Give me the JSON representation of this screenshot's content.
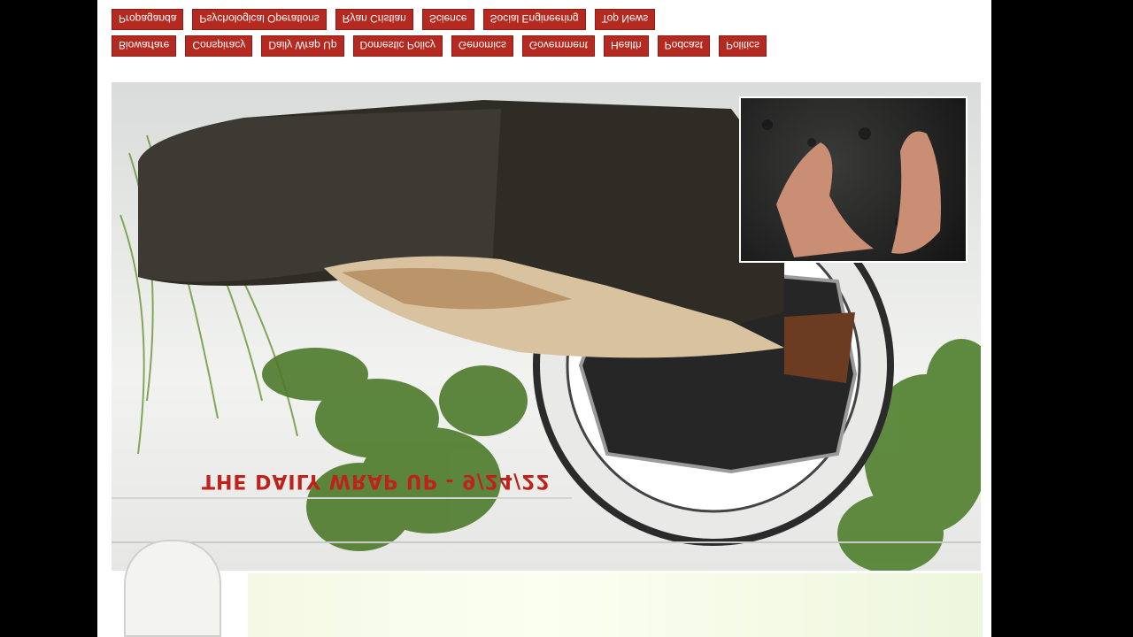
{
  "tags": {
    "row1": [
      "Propaganda",
      "Psychological Operations",
      "Ryan Cristian",
      "Science",
      "Social Engineering",
      "Top News"
    ],
    "row2": [
      "Biowarfare",
      "Conspiracy",
      "Daily Wrap Up",
      "Domestic Policy",
      "Genomics",
      "Government",
      "Health",
      "Podcast",
      "Politics"
    ]
  },
  "hero": {
    "title": "The Daily Wrap Up - 9/24/22"
  },
  "colors": {
    "tag_bg": "#b52a20",
    "title": "#c0211b",
    "background": "#ffffff"
  }
}
